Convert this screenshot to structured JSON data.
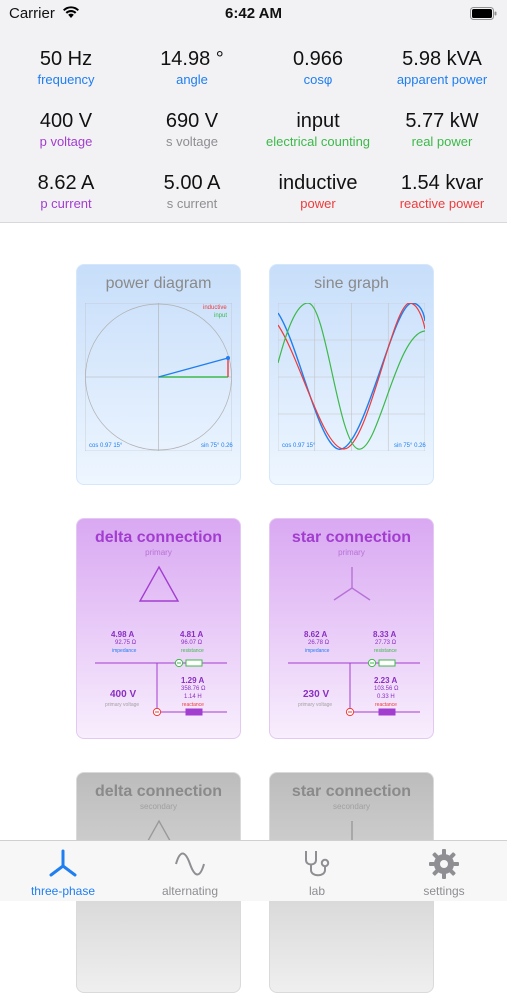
{
  "status_bar": {
    "carrier": "Carrier",
    "time": "6:42 AM"
  },
  "stats": [
    {
      "value": "50 Hz",
      "label": "frequency",
      "label_color": "#1f7ef0"
    },
    {
      "value": "14.98 °",
      "label": "angle",
      "label_color": "#1f7ef0"
    },
    {
      "value": "0.966",
      "label": "cosφ",
      "label_color": "#1f7ef0"
    },
    {
      "value": "5.98 kVA",
      "label": "apparent power",
      "label_color": "#1f7ef0"
    },
    {
      "value": "400 V",
      "label": "p voltage",
      "label_color": "#a33dd0"
    },
    {
      "value": "690 V",
      "label": "s voltage",
      "label_color": "#8e8e93"
    },
    {
      "value": "input",
      "label": "electrical counting",
      "label_color": "#3cb94a"
    },
    {
      "value": "5.77 kW",
      "label": "real power",
      "label_color": "#3cb94a"
    },
    {
      "value": "8.62 A",
      "label": "p current",
      "label_color": "#a33dd0"
    },
    {
      "value": "5.00 A",
      "label": "s current",
      "label_color": "#8e8e93"
    },
    {
      "value": "inductive",
      "label": "power",
      "label_color": "#ee3b3b"
    },
    {
      "value": "1.54 kvar",
      "label": "reactive power",
      "label_color": "#ee3b3b"
    }
  ],
  "cards": {
    "power_diagram": {
      "title": "power diagram",
      "legend_inductive": "inductive",
      "legend_input": "input",
      "foot_left": "cos 0.97 15°",
      "foot_right": "sin 75° 0.26"
    },
    "sine_graph": {
      "title": "sine graph",
      "foot_left": "cos 0.97 15°",
      "foot_right": "sin 75° 0.26"
    },
    "delta_primary": {
      "title": "delta connection",
      "subtitle": "primary",
      "current_left": "4.98 A",
      "impedance_val": "92.75 Ω",
      "impedance_lbl": "impedance",
      "current_right": "4.81 A",
      "resistance_val": "96.07 Ω",
      "resistance_lbl": "resistance",
      "current_lower": "1.29 A",
      "reactance_val": "358.76 Ω",
      "inductance_val": "1.14 H",
      "reactance_lbl": "reactance",
      "voltage": "400 V",
      "voltage_lbl": "primary voltage"
    },
    "star_primary": {
      "title": "star connection",
      "subtitle": "primary",
      "current_left": "8.62 A",
      "impedance_val": "26.78 Ω",
      "impedance_lbl": "impedance",
      "current_right": "8.33 A",
      "resistance_val": "27.73 Ω",
      "resistance_lbl": "resistance",
      "current_lower": "2.23 A",
      "reactance_val": "103.56 Ω",
      "inductance_val": "0.33 H",
      "reactance_lbl": "reactance",
      "voltage": "230 V",
      "voltage_lbl": "primary voltage"
    },
    "delta_secondary": {
      "title": "delta connection",
      "subtitle": "secondary"
    },
    "star_secondary": {
      "title": "star connection",
      "subtitle": "secondary"
    }
  },
  "tabs": [
    {
      "label": "three-phase",
      "icon": "three-phase-icon",
      "active": true
    },
    {
      "label": "alternating",
      "icon": "sine-wave-icon",
      "active": false
    },
    {
      "label": "lab",
      "icon": "stethoscope-icon",
      "active": false
    },
    {
      "label": "settings",
      "icon": "gear-icon",
      "active": false
    }
  ],
  "colors": {
    "accent": "#1f7ef0",
    "primary_purple": "#a33dd0",
    "green": "#3cb94a",
    "red": "#ee3b3b",
    "gray": "#8e8e93"
  }
}
